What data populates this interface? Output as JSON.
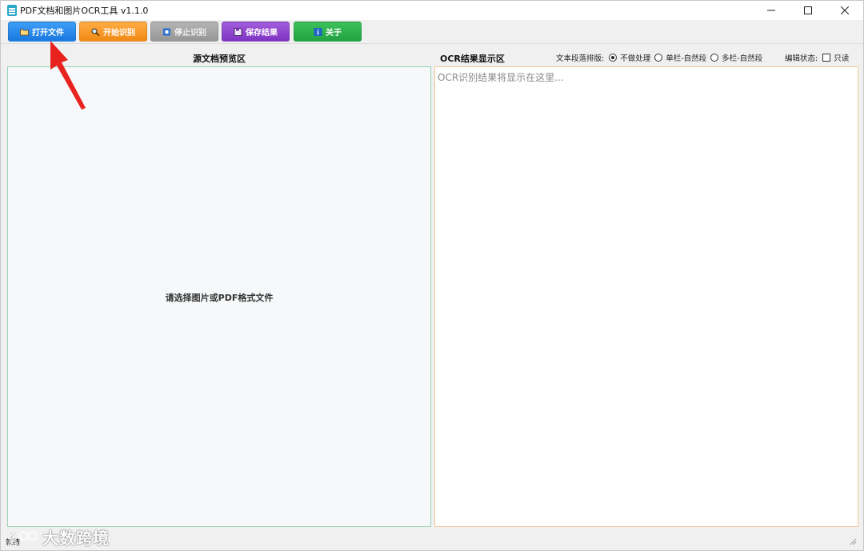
{
  "window": {
    "title": "PDF文档和图片OCR工具 v1.1.0",
    "controls": {
      "minimize": "—",
      "maximize": "☐",
      "close": "✕"
    }
  },
  "toolbar": {
    "open_label": "打开文件",
    "start_label": "开始识别",
    "stop_label": "停止识别",
    "save_label": "保存结果",
    "about_label": "关于"
  },
  "colors": {
    "open": "#1f7fe8",
    "start": "#f59a22",
    "stop": "#a3a3a3",
    "save": "#8a3fcd",
    "about": "#2cb04e",
    "arrow": "#e8231f"
  },
  "left_panel": {
    "header": "源文档预览区",
    "placeholder": "请选择图片或PDF格式文件"
  },
  "right_panel": {
    "header": "OCR结果显示区",
    "layout_label": "文本段落排版:",
    "layout_options": [
      "不做处理",
      "单栏-自然段",
      "多栏-自然段"
    ],
    "layout_selected": 0,
    "edit_state_label": "编辑状态:",
    "readonly_label": "只读",
    "readonly_checked": false,
    "result_placeholder": "OCR识别结果将显示在这里..."
  },
  "status": {
    "text": "就绪"
  },
  "watermark": {
    "text": "大数跨境"
  }
}
